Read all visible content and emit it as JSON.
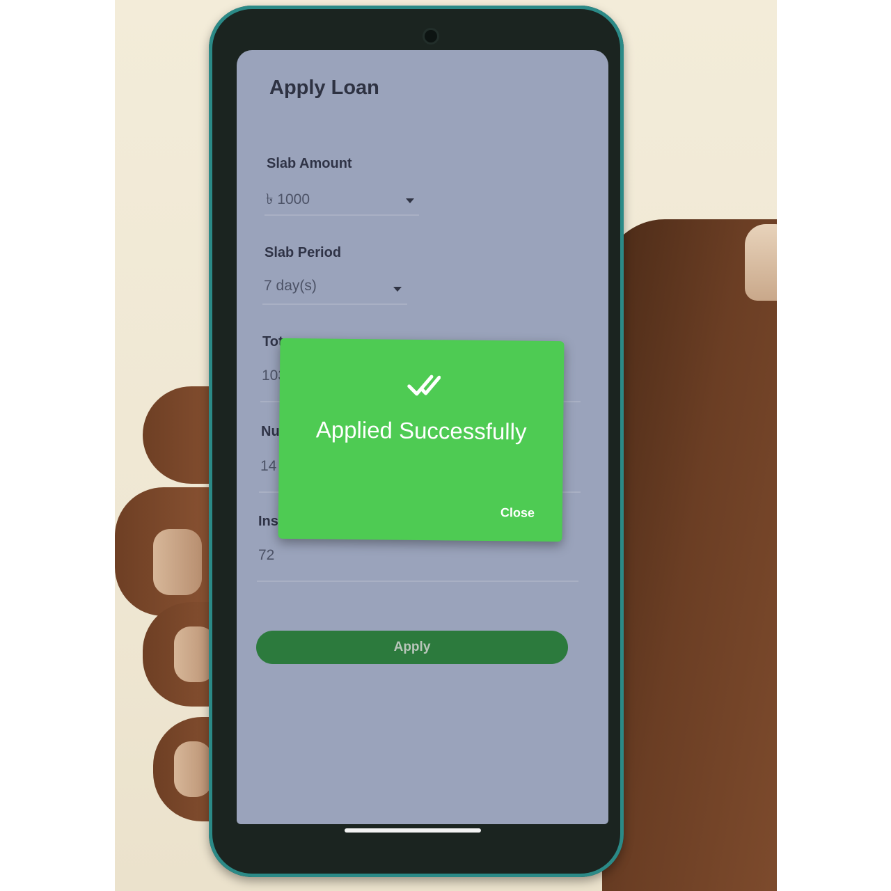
{
  "screen": {
    "title": "Apply Loan",
    "fields": [
      {
        "label": "Slab Amount",
        "value": "৳ 1000"
      },
      {
        "label": "Slab Period",
        "value": "7 day(s)"
      },
      {
        "label": "Tot",
        "value": "103"
      },
      {
        "label": "Nu",
        "value": "14"
      },
      {
        "label": "Ins",
        "value": "72"
      }
    ],
    "apply_label": "Apply"
  },
  "dialog": {
    "icon": "double-check-icon",
    "message": "Applied Successfully",
    "close_label": "Close"
  },
  "colors": {
    "screen_bg": "#9aa3bb",
    "dialog_bg": "#4ecb53",
    "apply_button": "#2c7a3d"
  }
}
